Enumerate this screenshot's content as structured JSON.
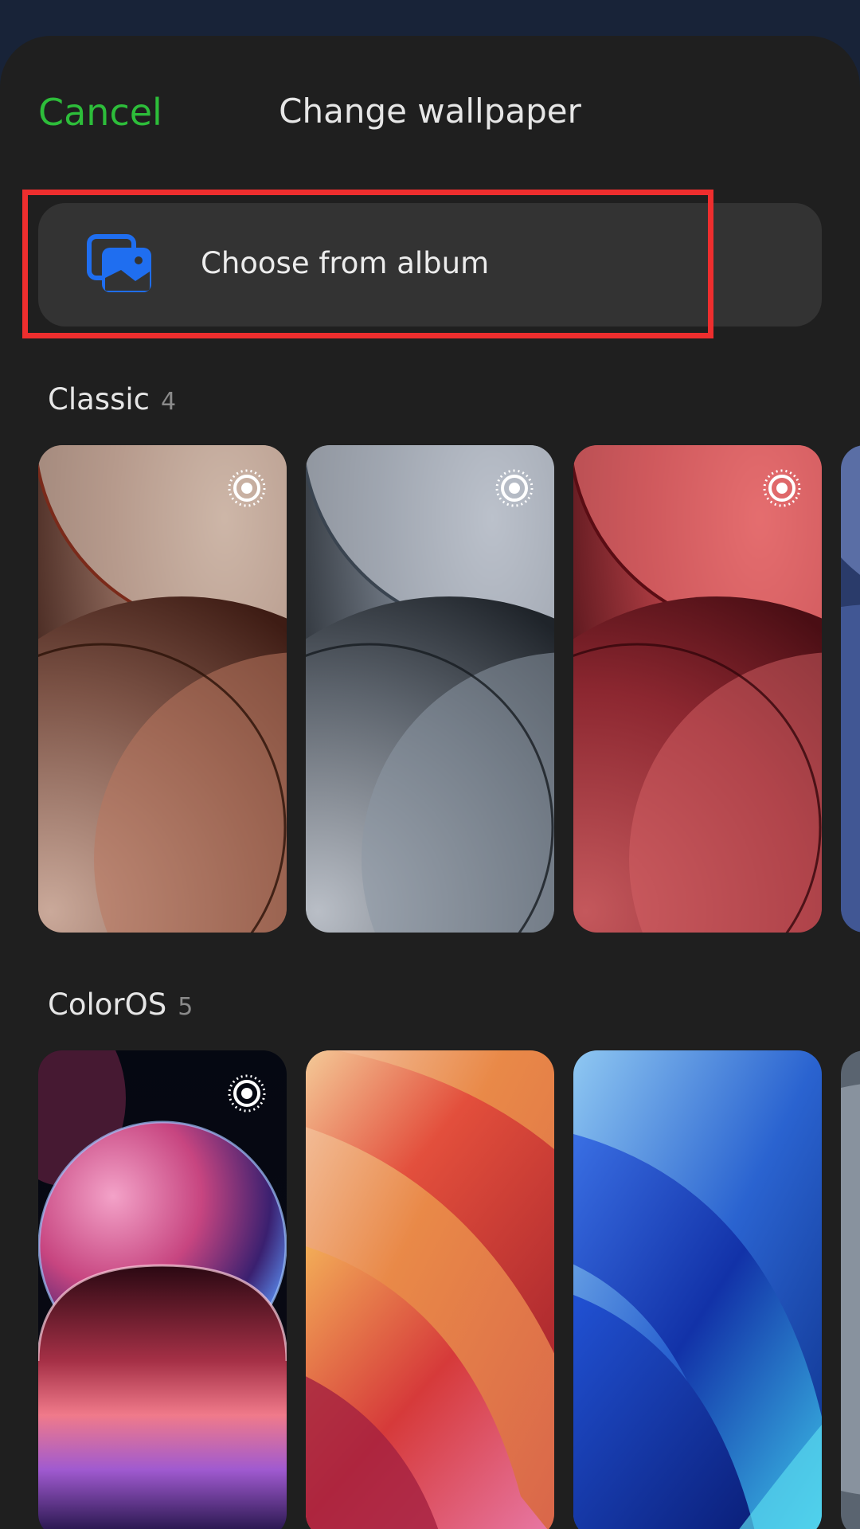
{
  "header": {
    "cancel_label": "Cancel",
    "title": "Change wallpaper"
  },
  "album": {
    "label": "Choose from album",
    "icon": "gallery-icon"
  },
  "sections": [
    {
      "name": "Classic",
      "count": "4",
      "items": [
        {
          "theme": "bronze",
          "live": true
        },
        {
          "theme": "silver",
          "live": true
        },
        {
          "theme": "crimson",
          "live": true
        },
        {
          "theme": "navy",
          "live": false
        }
      ]
    },
    {
      "name": "ColorOS",
      "count": "5",
      "items": [
        {
          "theme": "neon-night",
          "live": true
        },
        {
          "theme": "sunset-waves",
          "live": false
        },
        {
          "theme": "blue-waves",
          "live": false
        },
        {
          "theme": "grey",
          "live": false
        }
      ]
    }
  ],
  "colors": {
    "accent": "#2dbd3a",
    "highlight": "#ee2e2e",
    "card": "#333333",
    "sheet": "#1f1f1f"
  }
}
